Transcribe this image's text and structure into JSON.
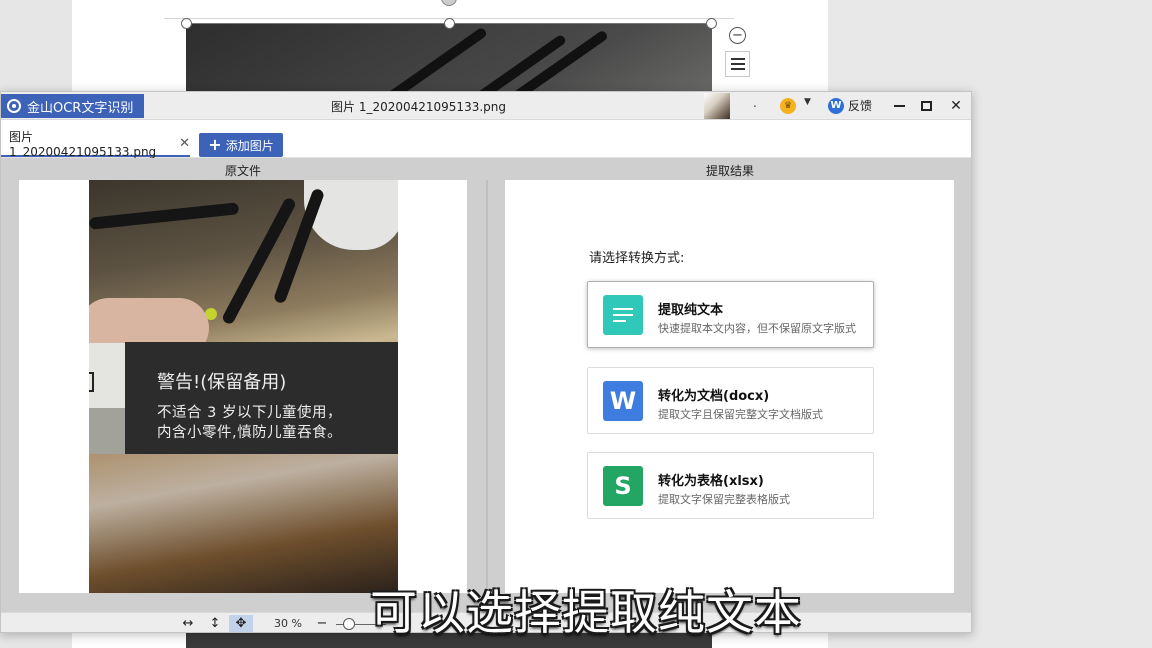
{
  "app": {
    "name": "金山OCR文字识别",
    "window_title": "图片 1_20200421095133.png",
    "separator": ".",
    "feedback_label": "反馈"
  },
  "tabs": {
    "file_tab_label": "图片 1_20200421095133.png",
    "add_image_label": "添加图片"
  },
  "panels": {
    "source_label": "原文件",
    "result_label": "提取结果"
  },
  "source_image": {
    "warning_title": "警告!(保留备用)",
    "warning_line1": "不适合 3 岁以下儿童使用，",
    "warning_line2": "内含小零件,慎防儿童吞食。"
  },
  "result": {
    "prompt": "请选择转换方式:",
    "options": [
      {
        "title": "提取纯文本",
        "desc": "快速提取本文内容，但不保留原文字版式",
        "icon": "text-lines-icon",
        "color": "#2fc8b9",
        "selected": true
      },
      {
        "title": "转化为文档(docx)",
        "desc": "提取文字且保留完整文字文档版式",
        "icon": "word-doc-icon",
        "glyph": "W",
        "color": "#3e7ce0",
        "selected": false
      },
      {
        "title": "转化为表格(xlsx)",
        "desc": "提取文字保留完整表格版式",
        "icon": "spreadsheet-icon",
        "glyph": "S",
        "color": "#23a563",
        "selected": false
      }
    ]
  },
  "statusbar": {
    "zoom": "30 %"
  },
  "caption": "可以选择提取纯文本",
  "colors": {
    "accent": "#3d63b9",
    "text_option": "#2fc8b9",
    "doc_option": "#3e7ce0",
    "sheet_option": "#23a563"
  }
}
